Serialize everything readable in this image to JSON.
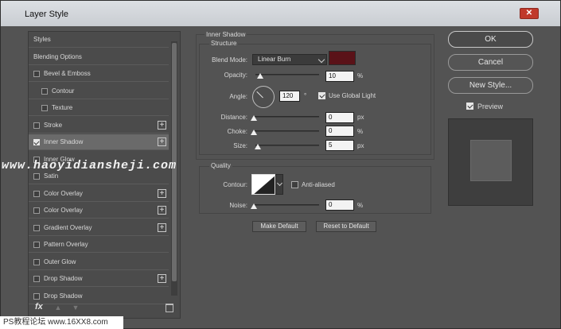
{
  "window": {
    "title": "Layer Style",
    "close": "✕"
  },
  "left_panel": {
    "items": [
      {
        "label": "Styles",
        "checkbox": false,
        "checked": false,
        "plus": false
      },
      {
        "label": "Blending Options",
        "checkbox": false,
        "checked": false,
        "plus": false
      },
      {
        "label": "Bevel & Emboss",
        "checkbox": true,
        "checked": false,
        "plus": false
      },
      {
        "label": "Contour",
        "checkbox": true,
        "checked": false,
        "plus": false,
        "indent": true
      },
      {
        "label": "Texture",
        "checkbox": true,
        "checked": false,
        "plus": false,
        "indent": true
      },
      {
        "label": "Stroke",
        "checkbox": true,
        "checked": false,
        "plus": true
      },
      {
        "label": "Inner Shadow",
        "checkbox": true,
        "checked": true,
        "plus": true,
        "selected": true
      },
      {
        "label": "Inner Glow",
        "checkbox": true,
        "checked": false,
        "plus": false
      },
      {
        "label": "Satin",
        "checkbox": true,
        "checked": false,
        "plus": false
      },
      {
        "label": "Color Overlay",
        "checkbox": true,
        "checked": false,
        "plus": true
      },
      {
        "label": "Color Overlay",
        "checkbox": true,
        "checked": false,
        "plus": true
      },
      {
        "label": "Gradient Overlay",
        "checkbox": true,
        "checked": false,
        "plus": true
      },
      {
        "label": "Pattern Overlay",
        "checkbox": true,
        "checked": false,
        "plus": false
      },
      {
        "label": "Outer Glow",
        "checkbox": true,
        "checked": false,
        "plus": false
      },
      {
        "label": "Drop Shadow",
        "checkbox": true,
        "checked": false,
        "plus": true
      },
      {
        "label": "Drop Shadow",
        "checkbox": true,
        "checked": false,
        "plus": false
      }
    ],
    "fx": "fx"
  },
  "inner_shadow": {
    "group_title": "Inner Shadow",
    "structure_title": "Structure",
    "blend_mode_label": "Blend Mode:",
    "blend_mode_value": "Linear Burn",
    "color": "#5a1218",
    "opacity_label": "Opacity:",
    "opacity_value": "10",
    "opacity_unit": "%",
    "angle_label": "Angle:",
    "angle_value": "120",
    "angle_unit": "°",
    "global_light_label": "Use Global Light",
    "distance_label": "Distance:",
    "distance_value": "0",
    "distance_unit": "px",
    "choke_label": "Choke:",
    "choke_value": "0",
    "choke_unit": "%",
    "size_label": "Size:",
    "size_value": "5",
    "size_unit": "px",
    "quality_title": "Quality",
    "contour_label": "Contour:",
    "anti_aliased_label": "Anti-aliased",
    "noise_label": "Noise:",
    "noise_value": "0",
    "noise_unit": "%",
    "make_default": "Make Default",
    "reset_default": "Reset to Default"
  },
  "right": {
    "ok": "OK",
    "cancel": "Cancel",
    "new_style": "New Style...",
    "preview_label": "Preview"
  },
  "watermark": "www.haoyidiansheji.com",
  "footer": "PS教程论坛 www.16XX8.com"
}
